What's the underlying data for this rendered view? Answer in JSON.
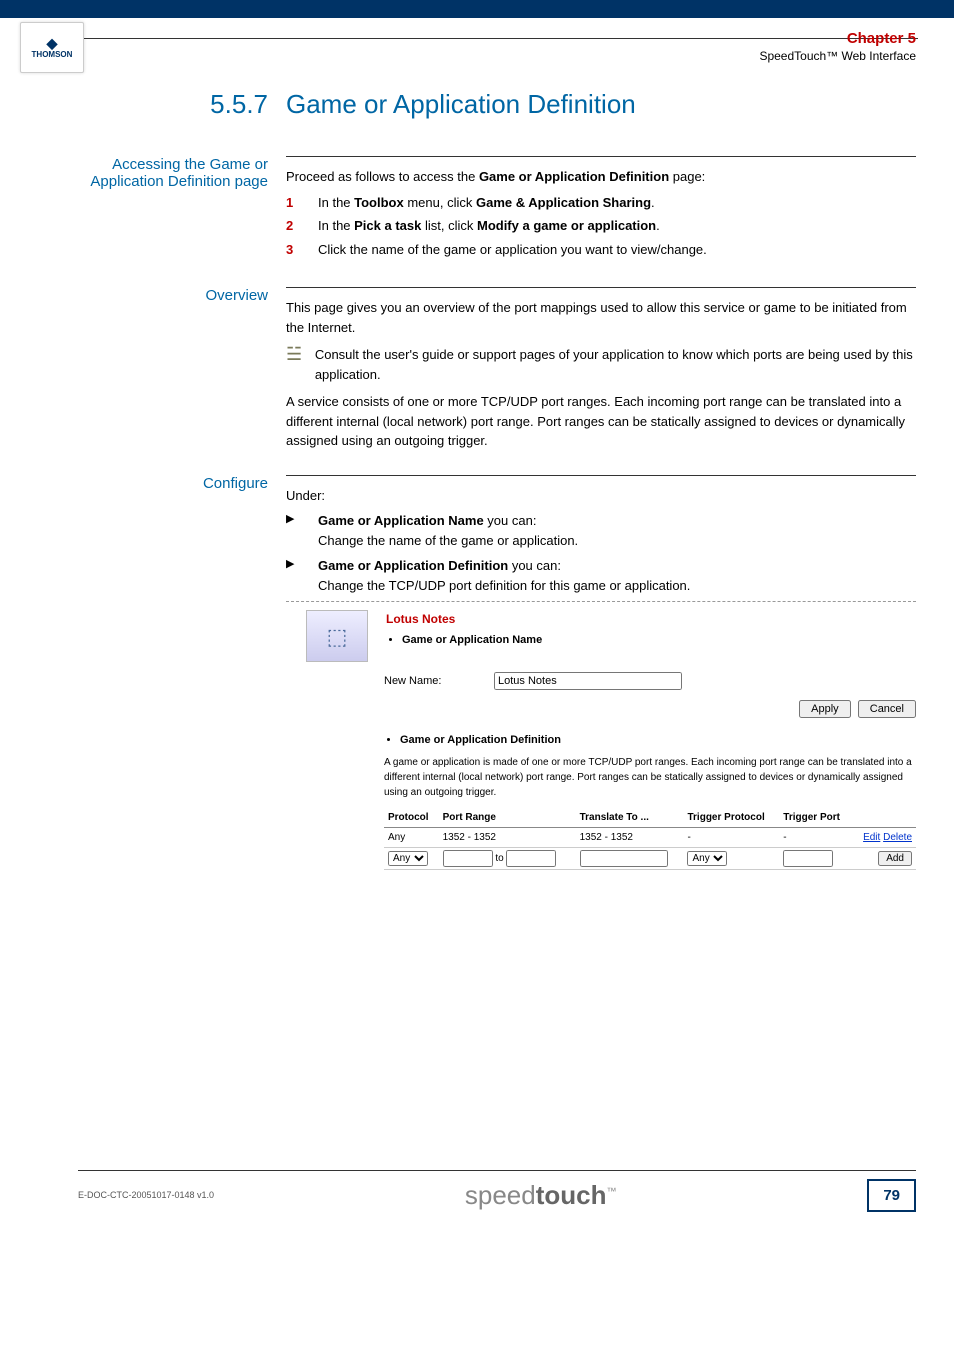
{
  "header": {
    "logo_brand": "THOMSON",
    "chapter": "Chapter 5",
    "subhead": "SpeedTouch™ Web Interface"
  },
  "section": {
    "number": "5.5.7",
    "title": "Game or Application Definition"
  },
  "access": {
    "label": "Accessing the Game or Application Definition page",
    "intro_pre": "Proceed as follows to access the ",
    "intro_bold": "Game or Application Definition",
    "intro_post": " page:",
    "steps": [
      {
        "pre": "In the ",
        "b1": "Toolbox",
        "mid": " menu, click ",
        "b2": "Game & Application Sharing",
        "post": "."
      },
      {
        "pre": "In the ",
        "b1": "Pick a task",
        "mid": " list, click ",
        "b2": "Modify a game or application",
        "post": "."
      },
      {
        "pre": "Click the name of the game or application you want to view/change.",
        "b1": "",
        "mid": "",
        "b2": "",
        "post": ""
      }
    ]
  },
  "overview": {
    "label": "Overview",
    "p1": "This page gives you an overview of the port mappings used to allow this service or game to be initiated from the Internet.",
    "note": "Consult the user's guide or support pages of your application to know which ports are being used by this application.",
    "p2": "A service consists of one or more TCP/UDP port ranges. Each incoming port range can be translated into a different internal (local network) port range. Port ranges can be statically assigned to devices or dynamically assigned using an outgoing trigger."
  },
  "configure": {
    "label": "Configure",
    "under": "Under:",
    "items": [
      {
        "b": "Game or Application Name",
        "tail": " you can:",
        "desc": "Change the name of the game or application."
      },
      {
        "b": "Game or Application Definition",
        "tail": " you can:",
        "desc": "Change the TCP/UDP port definition for this game or application."
      }
    ]
  },
  "embed": {
    "title": "Lotus Notes",
    "name_heading": "Game or Application Name",
    "new_name_label": "New Name:",
    "new_name_value": "Lotus Notes",
    "apply": "Apply",
    "cancel": "Cancel",
    "def_heading": "Game or Application Definition",
    "def_desc": "A game or application is made of one or more TCP/UDP port ranges. Each incoming port range can be translated into a different internal (local network) port range. Port ranges can be statically assigned to devices or dynamically assigned using an outgoing trigger.",
    "cols": {
      "protocol": "Protocol",
      "port_range": "Port Range",
      "translate": "Translate To ...",
      "trig_proto": "Trigger Protocol",
      "trig_port": "Trigger Port"
    },
    "row1": {
      "protocol": "Any",
      "port_range": "1352 - 1352",
      "translate": "1352 - 1352",
      "trig_proto": "-",
      "trig_port": "-",
      "edit": "Edit",
      "delete": "Delete"
    },
    "row2": {
      "protocol_sel": "Any",
      "to": "to",
      "trig_sel": "Any",
      "add": "Add"
    }
  },
  "footer": {
    "docref": "E-DOC-CTC-20051017-0148 v1.0",
    "brand_light": "speed",
    "brand_bold": "touch",
    "tm": "™",
    "page": "79"
  }
}
